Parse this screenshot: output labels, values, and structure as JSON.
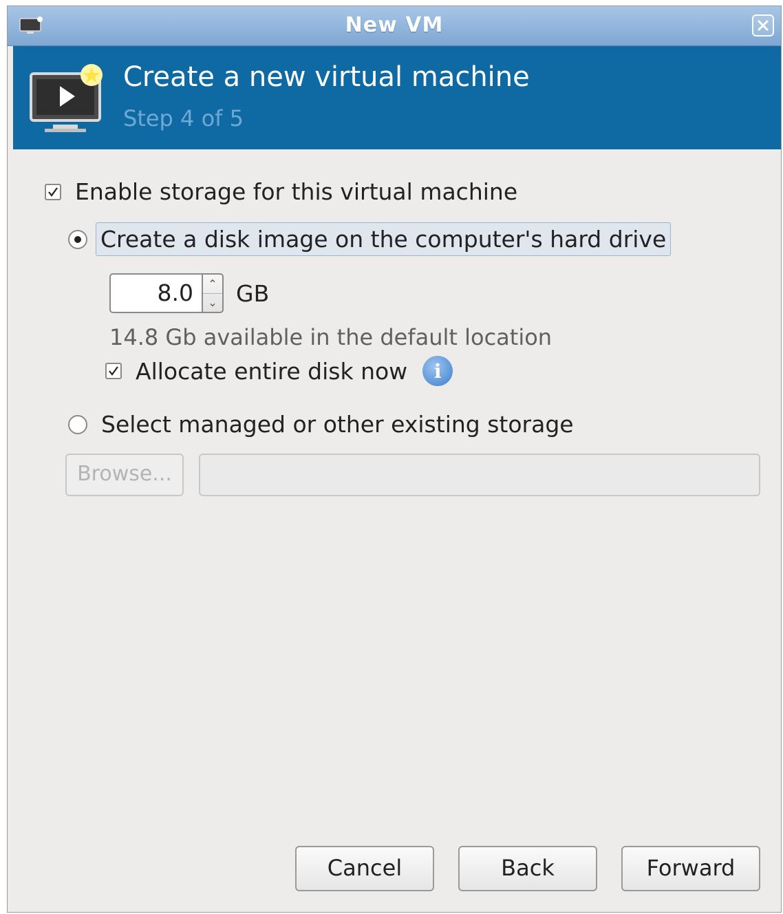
{
  "window": {
    "title": "New VM",
    "icon": "vm-window-icon",
    "close_icon": "close-icon"
  },
  "header": {
    "heading": "Create a new virtual machine",
    "step": "Step 4 of 5",
    "icon": "new-vm-icon",
    "bg_color": "#0f6aa3"
  },
  "storage": {
    "enable_label": "Enable storage for this virtual machine",
    "enable_checked": true,
    "create_disk_label": "Create a disk image on the computer's hard drive",
    "create_disk_selected": true,
    "size_value": "8.0",
    "size_unit": "GB",
    "available_text": "14.8 Gb available in the default location",
    "allocate_label": "Allocate entire disk now",
    "allocate_checked": true,
    "info_icon": "info-icon",
    "existing_label": "Select managed or other existing storage",
    "existing_selected": false,
    "browse_label": "Browse...",
    "path_value": ""
  },
  "buttons": {
    "cancel": "Cancel",
    "back": "Back",
    "forward": "Forward"
  }
}
